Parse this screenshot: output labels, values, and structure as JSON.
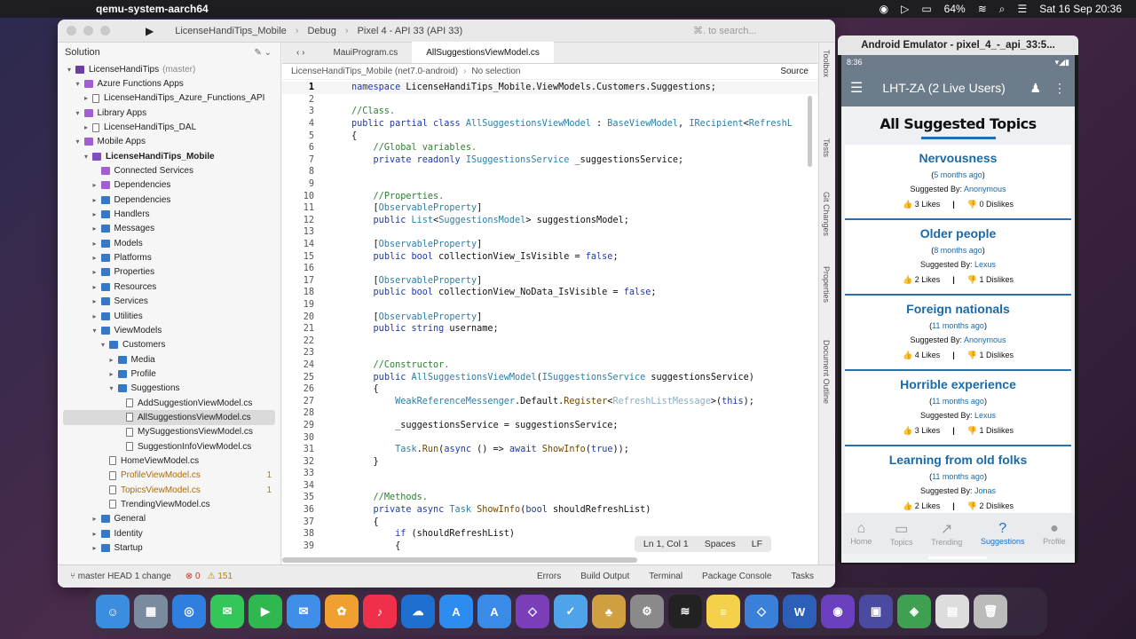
{
  "menubar": {
    "app": "qemu-system-aarch64",
    "battery": "64%",
    "datetime": "Sat 16 Sep  20:36"
  },
  "vs": {
    "project": "LicenseHandiTips_Mobile",
    "config": "Debug",
    "device": "Pixel 4 - API 33 (API 33)",
    "search_placeholder": "⌘. to search...",
    "solution_title": "Solution",
    "tree": [
      {
        "label": "LicenseHandiTips",
        "extra": "(master)",
        "indent": 0,
        "chev": "▾",
        "icon": "sln"
      },
      {
        "label": "Azure Functions Apps",
        "indent": 1,
        "chev": "▾",
        "icon": "svc"
      },
      {
        "label": "LicenseHandiTips_Azure_Functions_API",
        "indent": 2,
        "chev": "▸",
        "icon": "file"
      },
      {
        "label": "Library Apps",
        "indent": 1,
        "chev": "▾",
        "icon": "svc"
      },
      {
        "label": "LicenseHandiTips_DAL",
        "indent": 2,
        "chev": "▸",
        "icon": "file"
      },
      {
        "label": "Mobile Apps",
        "indent": 1,
        "chev": "▾",
        "icon": "svc"
      },
      {
        "label": "LicenseHandiTips_Mobile",
        "indent": 2,
        "chev": "▾",
        "icon": "proj",
        "bold": true
      },
      {
        "label": "Connected Services",
        "indent": 3,
        "chev": "",
        "icon": "svc"
      },
      {
        "label": "Dependencies",
        "indent": 3,
        "chev": "▸",
        "icon": "svc"
      },
      {
        "label": "Dependencies",
        "indent": 3,
        "chev": "▸",
        "icon": "folder"
      },
      {
        "label": "Handlers",
        "indent": 3,
        "chev": "▸",
        "icon": "folder"
      },
      {
        "label": "Messages",
        "indent": 3,
        "chev": "▸",
        "icon": "folder"
      },
      {
        "label": "Models",
        "indent": 3,
        "chev": "▸",
        "icon": "folder"
      },
      {
        "label": "Platforms",
        "indent": 3,
        "chev": "▸",
        "icon": "folder"
      },
      {
        "label": "Properties",
        "indent": 3,
        "chev": "▸",
        "icon": "folder"
      },
      {
        "label": "Resources",
        "indent": 3,
        "chev": "▸",
        "icon": "folder"
      },
      {
        "label": "Services",
        "indent": 3,
        "chev": "▸",
        "icon": "folder"
      },
      {
        "label": "Utilities",
        "indent": 3,
        "chev": "▸",
        "icon": "folder"
      },
      {
        "label": "ViewModels",
        "indent": 3,
        "chev": "▾",
        "icon": "folder"
      },
      {
        "label": "Customers",
        "indent": 4,
        "chev": "▾",
        "icon": "folder"
      },
      {
        "label": "Media",
        "indent": 5,
        "chev": "▸",
        "icon": "folder"
      },
      {
        "label": "Profile",
        "indent": 5,
        "chev": "▸",
        "icon": "folder"
      },
      {
        "label": "Suggestions",
        "indent": 5,
        "chev": "▾",
        "icon": "folder"
      },
      {
        "label": "AddSuggestionViewModel.cs",
        "indent": 6,
        "chev": "",
        "icon": "file"
      },
      {
        "label": "AllSuggestionsViewModel.cs",
        "indent": 6,
        "chev": "",
        "icon": "file",
        "selected": true
      },
      {
        "label": "MySuggestionsViewModel.cs",
        "indent": 6,
        "chev": "",
        "icon": "file"
      },
      {
        "label": "SuggestionInfoViewModel.cs",
        "indent": 6,
        "chev": "",
        "icon": "file"
      },
      {
        "label": "HomeViewModel.cs",
        "indent": 4,
        "chev": "",
        "icon": "file"
      },
      {
        "label": "ProfileViewModel.cs",
        "indent": 4,
        "chev": "",
        "icon": "file",
        "mod": true,
        "badge": "1"
      },
      {
        "label": "TopicsViewModel.cs",
        "indent": 4,
        "chev": "",
        "icon": "file",
        "mod": true,
        "badge": "1"
      },
      {
        "label": "TrendingViewModel.cs",
        "indent": 4,
        "chev": "",
        "icon": "file"
      },
      {
        "label": "General",
        "indent": 3,
        "chev": "▸",
        "icon": "folder"
      },
      {
        "label": "Identity",
        "indent": 3,
        "chev": "▸",
        "icon": "folder"
      },
      {
        "label": "Startup",
        "indent": 3,
        "chev": "▸",
        "icon": "folder"
      }
    ],
    "tabs": [
      "MauiProgram.cs",
      "AllSuggestionsViewModel.cs"
    ],
    "nav_path": "LicenseHandiTips_Mobile (net7.0-android)",
    "nav_selection": "No selection",
    "source": "Source",
    "code": [
      "<span class=\"kw\">namespace</span> LicenseHandiTips_Mobile.ViewModels.Customers.Suggestions;",
      "",
      "<span class=\"cm\">//Class.</span>",
      "<span class=\"kw\">public partial class</span> <span class=\"ty\">AllSuggestionsViewModel</span> : <span class=\"ty\">BaseViewModel</span>, <span class=\"ty\">IRecipient</span>&lt;<span class=\"ty\">RefreshL</span>",
      "{",
      "    <span class=\"cm\">//Global variables.</span>",
      "    <span class=\"kw\">private readonly</span> <span class=\"ty\">ISuggestionsService</span> _suggestionsService;",
      "",
      "",
      "    <span class=\"cm\">//Properties.</span>",
      "    [<span class=\"attr\">ObservableProperty</span>]",
      "    <span class=\"kw\">public</span> <span class=\"ty\">List</span>&lt;<span class=\"ty\">SuggestionsModel</span>&gt; suggestionsModel;",
      "",
      "    [<span class=\"attr\">ObservableProperty</span>]",
      "    <span class=\"kw\">public bool</span> collectionView_IsVisible = <span class=\"kw\">false</span>;",
      "",
      "    [<span class=\"attr\">ObservableProperty</span>]",
      "    <span class=\"kw\">public bool</span> collectionView_NoData_IsVisible = <span class=\"kw\">false</span>;",
      "",
      "    [<span class=\"attr\">ObservableProperty</span>]",
      "    <span class=\"kw\">public string</span> username;",
      "",
      "",
      "    <span class=\"cm\">//Constructor.</span>",
      "    <span class=\"kw\">public</span> <span class=\"ty\">AllSuggestionsViewModel</span>(<span class=\"ty\">ISuggestionsService</span> suggestionsService)",
      "    {",
      "        <span class=\"ty\">WeakReferenceMessenger</span>.Default.<span class=\"fn\">Register</span>&lt;<span class=\"ty\" style=\"color:#88aec4\">RefreshListMessage</span>&gt;(<span class=\"kw\">this</span>);",
      "",
      "        _suggestionsService = suggestionsService;",
      "",
      "        <span class=\"ty\">Task</span>.<span class=\"fn\">Run</span>(<span class=\"kw\">async</span> () =&gt; <span class=\"kw\">await</span> <span class=\"fn\">ShowInfo</span>(<span class=\"kw\">true</span>));",
      "    }",
      "",
      "",
      "    <span class=\"cm\">//Methods.</span>",
      "    <span class=\"kw\">private async</span> <span class=\"ty\">Task</span> <span class=\"fn\">ShowInfo</span>(<span class=\"kw\">bool</span> shouldRefreshList)",
      "    {",
      "        <span class=\"kw\">if</span> (shouldRefreshList)",
      "        {"
    ],
    "status_ln": "Ln 1, Col 1",
    "status_spaces": "Spaces",
    "status_lf": "LF",
    "side_tabs": [
      "Toolbox",
      "Tests",
      "Git Changes",
      "Properties",
      "Document Outline"
    ],
    "bottom": {
      "branch": "master",
      "head": "HEAD",
      "changes": "1 change",
      "errors": "0",
      "warnings": "151",
      "tabs": [
        "Errors",
        "Build Output",
        "Terminal",
        "Package Console",
        "Tasks"
      ]
    }
  },
  "emulator": {
    "title": "Android Emulator - pixel_4_-_api_33:5...",
    "time": "8:36",
    "app_title": "LHT-ZA (2 Live Users)",
    "page_title": "All Suggested Topics",
    "suggested_by_label": "Suggested By:",
    "likes_label": "Likes",
    "dislikes_label": "Dislikes",
    "cards": [
      {
        "title": "Nervousness",
        "ago": "5 months ago",
        "by": "Anonymous",
        "likes": "3",
        "dislikes": "0"
      },
      {
        "title": "Older people",
        "ago": "8 months ago",
        "by": "Lexus",
        "likes": "2",
        "dislikes": "1"
      },
      {
        "title": "Foreign nationals",
        "ago": "11 months ago",
        "by": "Anonymous",
        "likes": "4",
        "dislikes": "1"
      },
      {
        "title": "Horrible experience",
        "ago": "11 months ago",
        "by": "Lexus",
        "likes": "3",
        "dislikes": "1"
      },
      {
        "title": "Learning from old folks",
        "ago": "11 months ago",
        "by": "Jonas",
        "likes": "2",
        "dislikes": "2"
      }
    ],
    "navtabs": [
      {
        "label": "Home",
        "icon": "⌂",
        "active": false
      },
      {
        "label": "Topics",
        "icon": "▭",
        "active": false
      },
      {
        "label": "Trending",
        "icon": "↗",
        "active": false
      },
      {
        "label": "Suggestions",
        "icon": "?",
        "active": true
      },
      {
        "label": "Profile",
        "icon": "●",
        "active": false
      }
    ]
  },
  "dock": [
    {
      "name": "finder-icon",
      "color": "#3b8de0",
      "g": "☺"
    },
    {
      "name": "launchpad-icon",
      "color": "#7a8ba0",
      "g": "▦"
    },
    {
      "name": "safari-icon",
      "color": "#2f7fe0",
      "g": "◎"
    },
    {
      "name": "messages-icon",
      "color": "#33c759",
      "g": "✉"
    },
    {
      "name": "facetime-icon",
      "color": "#2fb84f",
      "g": "▶"
    },
    {
      "name": "mail-icon",
      "color": "#3f8ee8",
      "g": "✉"
    },
    {
      "name": "photos-icon",
      "color": "#f0a030",
      "g": "✿"
    },
    {
      "name": "music-icon",
      "color": "#f0304a",
      "g": "♪"
    },
    {
      "name": "onedrive-icon",
      "color": "#1e6fd0",
      "g": "☁"
    },
    {
      "name": "app-store-icon",
      "color": "#2d8cf0",
      "g": "A"
    },
    {
      "name": "xcode-icon",
      "color": "#3a8be8",
      "g": "A"
    },
    {
      "name": "visual-studio-icon",
      "color": "#7a3fb8",
      "g": "◇"
    },
    {
      "name": "system-info-icon",
      "color": "#4fa3e8",
      "g": "✓"
    },
    {
      "name": "cocktail-icon",
      "color": "#d0a040",
      "g": "♣"
    },
    {
      "name": "settings-icon",
      "color": "#8a8a8a",
      "g": "⚙"
    },
    {
      "name": "voice-memos-icon",
      "color": "#222222",
      "g": "≋"
    },
    {
      "name": "notes-icon",
      "color": "#f5d04a",
      "g": "≡"
    },
    {
      "name": "simulator-icon",
      "color": "#3a7fd8",
      "g": "◇"
    },
    {
      "name": "word-icon",
      "color": "#2b5fb8",
      "g": "W"
    },
    {
      "name": "podcast-icon",
      "color": "#6a3fc0",
      "g": "◉"
    },
    {
      "name": "app-icon",
      "color": "#4a4aa0",
      "g": "▣"
    },
    {
      "name": "android-studio-icon",
      "color": "#3ea050",
      "g": "◈"
    },
    {
      "name": "preview-icon",
      "color": "#dddddd",
      "g": "▤"
    },
    {
      "name": "trash-icon",
      "color": "#bbbbbb",
      "g": "🗑"
    }
  ]
}
